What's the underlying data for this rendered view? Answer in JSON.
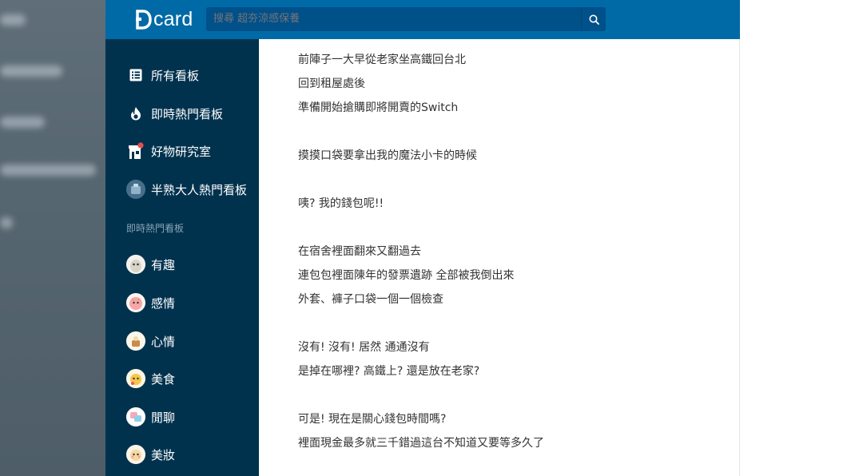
{
  "header": {
    "logo_text": "card",
    "search_placeholder": "搜尋 超夯涼感保養",
    "search_icon": "search-icon",
    "brand_color": "#006aa6"
  },
  "sidebar": {
    "items": [
      {
        "label": "所有看板",
        "icon": "list-icon"
      },
      {
        "label": "即時熱門看板",
        "icon": "fire-icon"
      },
      {
        "label": "好物研究室",
        "icon": "shop-icon"
      },
      {
        "label": "半熟大人熱門看板",
        "icon": "board-avatar-icon"
      }
    ],
    "section_title": "即時熱門看板",
    "boards": [
      {
        "label": "有趣",
        "icon": "funny-avatar-icon"
      },
      {
        "label": "感情",
        "icon": "relationship-avatar-icon"
      },
      {
        "label": "心情",
        "icon": "mood-avatar-icon"
      },
      {
        "label": "美食",
        "icon": "food-avatar-icon"
      },
      {
        "label": "閒聊",
        "icon": "chat-avatar-icon"
      },
      {
        "label": "美妝",
        "icon": "makeup-avatar-icon"
      }
    ]
  },
  "post": {
    "paragraphs": [
      [
        "前陣子一大早從老家坐高鐵回台北",
        "回到租屋處後",
        "準備開始搶購即將開賣的Switch"
      ],
      [
        "摸摸口袋要拿出我的魔法小卡的時候"
      ],
      [
        "咦? 我的錢包呢!!"
      ],
      [
        "在宿舍裡面翻來又翻過去",
        "連包包裡面陳年的發票遺跡 全部被我倒出來",
        "外套、褲子口袋一個一個檢查"
      ],
      [
        "沒有! 沒有! 居然 通通沒有",
        "是掉在哪裡? 高鐵上? 還是放在老家?"
      ],
      [
        "可是! 現在是關心錢包時間嗎?",
        "裡面現金最多就三千錯過這台不知道又要等多久了"
      ]
    ]
  }
}
